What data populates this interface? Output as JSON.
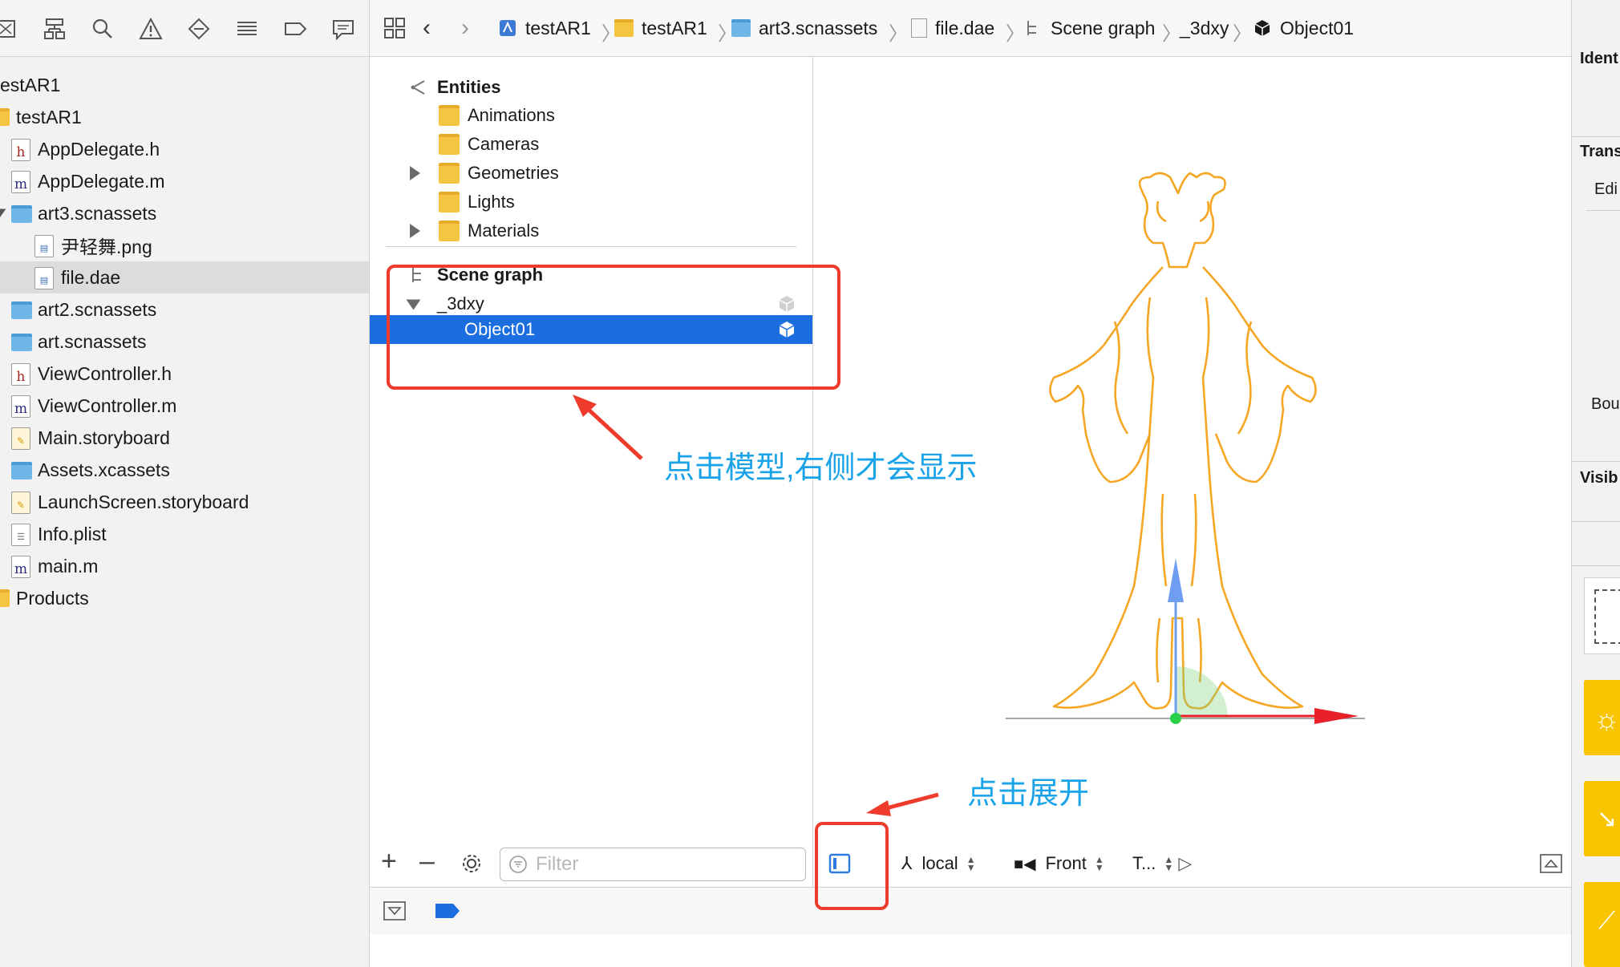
{
  "navigator": {
    "toolbar_icons": [
      "folder-icon",
      "hierarchy-icon",
      "search-icon",
      "warning-icon",
      "test-diamond-icon",
      "list-icon",
      "tag-icon",
      "chat-icon"
    ],
    "project_name": "estAR1",
    "items": [
      {
        "label": "testAR1",
        "icon": "folder-yellow"
      },
      {
        "label": "AppDelegate.h",
        "icon": "h-file"
      },
      {
        "label": "AppDelegate.m",
        "icon": "m-file"
      },
      {
        "label": "art3.scnassets",
        "icon": "folder-blue"
      },
      {
        "label": "尹轻舞.png",
        "icon": "image-file"
      },
      {
        "label": "file.dae",
        "icon": "dae-file"
      },
      {
        "label": "art2.scnassets",
        "icon": "folder-blue"
      },
      {
        "label": "art.scnassets",
        "icon": "folder-blue"
      },
      {
        "label": "ViewController.h",
        "icon": "h-file"
      },
      {
        "label": "ViewController.m",
        "icon": "m-file"
      },
      {
        "label": "Main.storyboard",
        "icon": "storyboard-file"
      },
      {
        "label": "Assets.xcassets",
        "icon": "folder-blue"
      },
      {
        "label": "LaunchScreen.storyboard",
        "icon": "storyboard-file"
      },
      {
        "label": "Info.plist",
        "icon": "plist-file"
      },
      {
        "label": "main.m",
        "icon": "m-file"
      },
      {
        "label": "Products",
        "icon": "folder-yellow"
      }
    ],
    "selected": "file.dae"
  },
  "jumpbar": {
    "crumbs": [
      "testAR1",
      "testAR1",
      "art3.scnassets",
      "file.dae",
      "Scene graph",
      "_3dxy",
      "Object01"
    ]
  },
  "outline": {
    "entities_label": "Entities",
    "entities": [
      "Animations",
      "Cameras",
      "Geometries",
      "Lights",
      "Materials"
    ],
    "scene_graph_label": "Scene graph",
    "root_node": "_3dxy",
    "child_node": "Object01",
    "filter_placeholder": "Filter"
  },
  "viewport": {
    "space_label": "local",
    "camera_label": "Front",
    "third_label": "T..."
  },
  "inspector": {
    "headers": [
      "Ident",
      "Trans",
      "Visib"
    ],
    "edit_label": "Edi",
    "bounds_label": "Bou"
  },
  "annotations": {
    "model_note": "点击模型,右侧才会显示",
    "expand_note": "点击展开",
    "color": "#1aa3e8",
    "box_color": "#ef3b2c"
  },
  "colors": {
    "selection_blue": "#1c6ee0",
    "model_orange": "#f5a623",
    "axis_red": "#e8202a",
    "axis_blue": "#6f9df0"
  }
}
